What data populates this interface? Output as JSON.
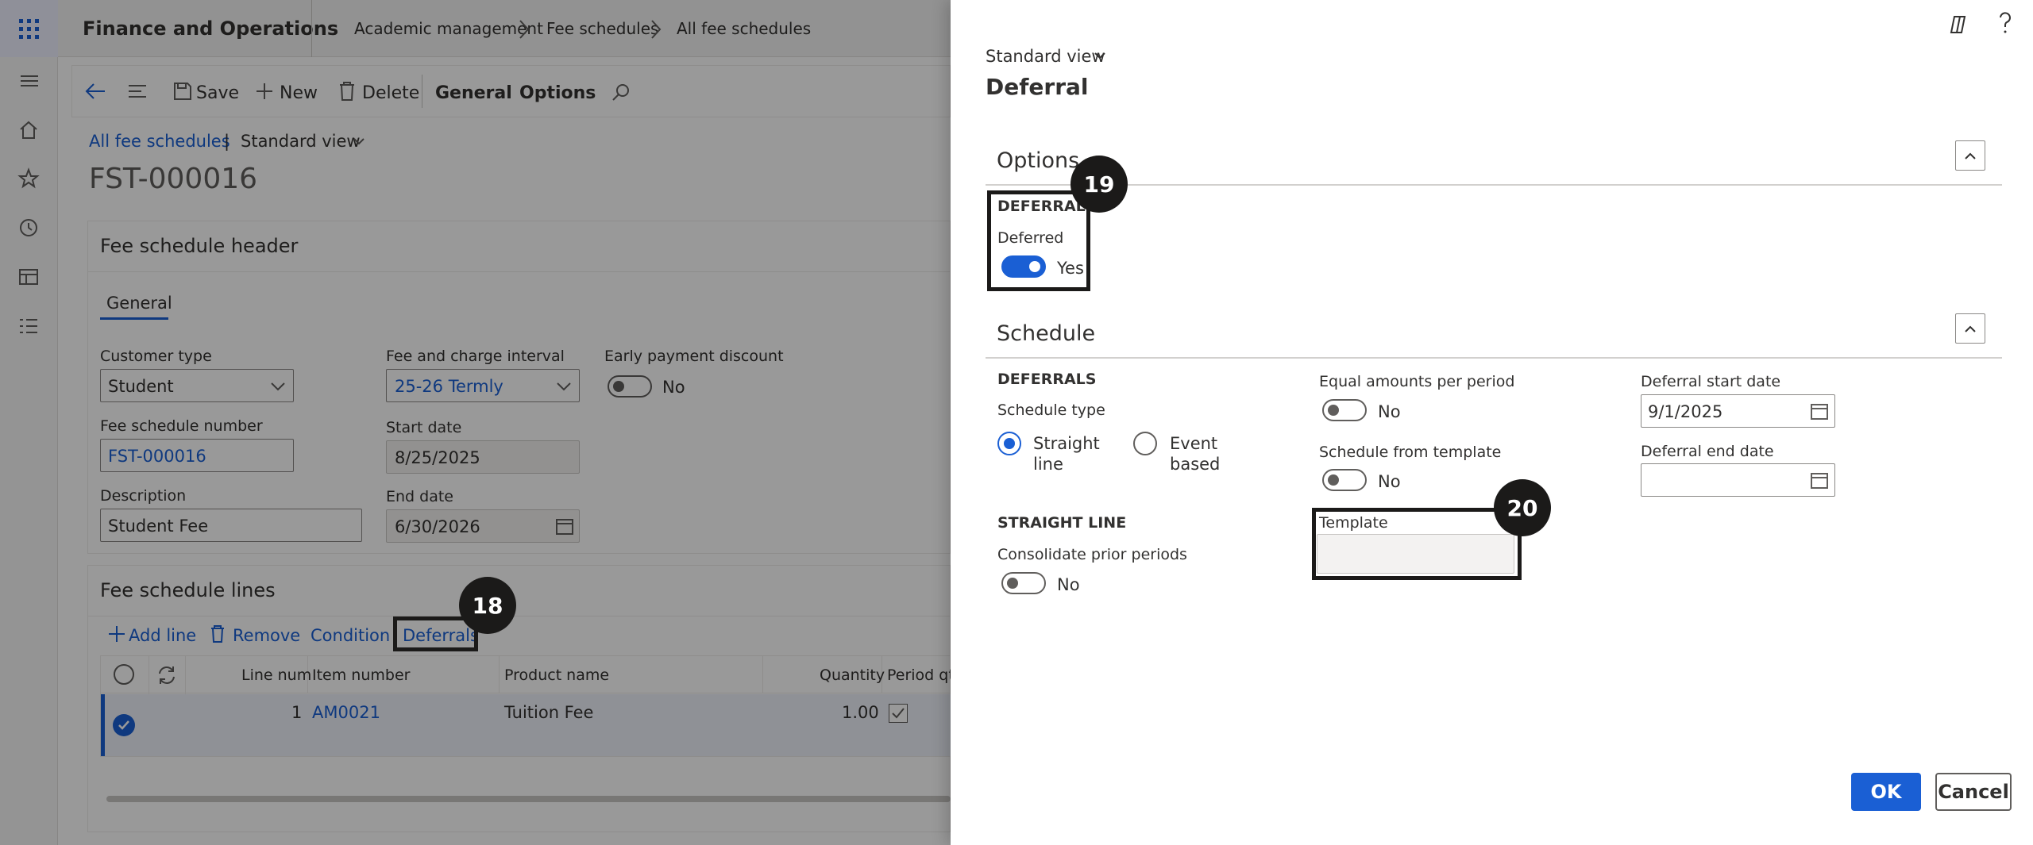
{
  "app": {
    "title": "Finance and Operations"
  },
  "breadcrumb": [
    "Academic management",
    "Fee schedules",
    "All fee schedules"
  ],
  "toolbar": {
    "save": "Save",
    "new": "New",
    "delete": "Delete",
    "general": "General",
    "options": "Options"
  },
  "page": {
    "view_link": "All fee schedules",
    "view_sep": "|",
    "view_name": "Standard view",
    "title": "FST-000016"
  },
  "header_section": {
    "title": "Fee schedule header",
    "tab": "General",
    "customer_type": {
      "label": "Customer type",
      "value": "Student"
    },
    "fee_interval": {
      "label": "Fee and charge interval",
      "value": "25-26 Termly"
    },
    "early_payment": {
      "label": "Early payment discount",
      "value": "No"
    },
    "schedule_number": {
      "label": "Fee schedule number",
      "value": "FST-000016"
    },
    "start_date": {
      "label": "Start date",
      "value": "8/25/2025"
    },
    "description": {
      "label": "Description",
      "value": "Student Fee"
    },
    "end_date": {
      "label": "End date",
      "value": "6/30/2026"
    }
  },
  "lines_section": {
    "title": "Fee schedule lines",
    "actions": {
      "add": "Add line",
      "remove": "Remove",
      "condition": "Condition",
      "deferrals": "Deferrals"
    },
    "columns": [
      "Line num",
      "Item number",
      "Product name",
      "Quantity",
      "Period qt"
    ],
    "rows": [
      {
        "line": "1",
        "item": "AM0021",
        "product": "Tuition Fee",
        "quantity": "1.00"
      }
    ]
  },
  "panel": {
    "view_name": "Standard view",
    "title": "Deferral",
    "options": {
      "title": "Options",
      "group_label": "DEFERRAL",
      "deferred_label": "Deferred",
      "deferred_value": "Yes"
    },
    "schedule": {
      "title": "Schedule",
      "deferrals_label": "DEFERRALS",
      "schedule_type_label": "Schedule type",
      "straight_line_1": "Straight",
      "straight_line_2": "line",
      "event_based_1": "Event",
      "event_based_2": "based",
      "straight_line_label": "STRAIGHT LINE",
      "consolidate_label": "Consolidate prior periods",
      "consolidate_value": "No",
      "equal_amounts_label": "Equal amounts per period",
      "equal_amounts_value": "No",
      "from_template_label": "Schedule from template",
      "from_template_value": "No",
      "template_label": "Template",
      "template_value": "",
      "start_date_label": "Deferral start date",
      "start_date_value": "9/1/2025",
      "end_date_label": "Deferral end date",
      "end_date_value": ""
    },
    "ok": "OK",
    "cancel": "Cancel"
  },
  "callouts": [
    "18",
    "19",
    "20"
  ],
  "colors": {
    "accent": "#1a5fd4",
    "app_bar": "#f3f3f3",
    "launcher": "#f0f1fb",
    "callout": "#1b1a19"
  }
}
